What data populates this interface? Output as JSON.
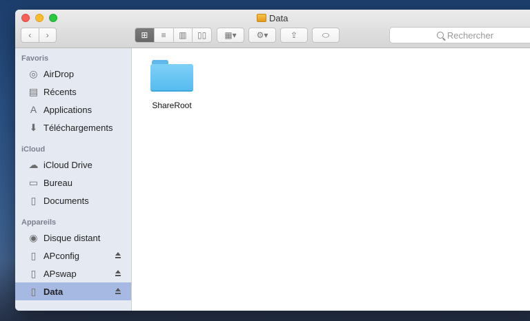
{
  "window": {
    "title": "Data"
  },
  "toolbar": {
    "back_glyph": "‹",
    "forward_glyph": "›",
    "view_icons": [
      "icon-view-icon",
      "list-view-icon",
      "column-view-icon",
      "gallery-view-icon"
    ],
    "arrange_glyph": "▦▾",
    "action_glyph": "⚙▾",
    "share_glyph": "⇪",
    "tag_glyph": "⬭"
  },
  "search": {
    "placeholder": "Rechercher"
  },
  "sidebar": {
    "sections": [
      {
        "title": "Favoris"
      },
      {
        "title": "iCloud"
      },
      {
        "title": "Appareils"
      }
    ],
    "favoris": [
      {
        "label": "AirDrop",
        "icon": "airdrop-icon",
        "glyph": "◎"
      },
      {
        "label": "Récents",
        "icon": "recents-icon",
        "glyph": "▤"
      },
      {
        "label": "Applications",
        "icon": "applications-icon",
        "glyph": "A"
      },
      {
        "label": "Téléchargements",
        "icon": "downloads-icon",
        "glyph": "⬇"
      }
    ],
    "icloud": [
      {
        "label": "iCloud Drive",
        "icon": "cloud-icon",
        "glyph": "☁"
      },
      {
        "label": "Bureau",
        "icon": "desktop-icon",
        "glyph": "▭"
      },
      {
        "label": "Documents",
        "icon": "documents-icon",
        "glyph": "▯"
      }
    ],
    "appareils": [
      {
        "label": "Disque distant",
        "icon": "remote-disc-icon",
        "glyph": "◉"
      },
      {
        "label": "APconfig",
        "icon": "drive-icon",
        "glyph": "▯"
      },
      {
        "label": "APswap",
        "icon": "drive-icon",
        "glyph": "▯"
      },
      {
        "label": "Data",
        "icon": "drive-icon",
        "glyph": "▯"
      }
    ]
  },
  "content": {
    "items": [
      {
        "label": "ShareRoot",
        "icon": "folder-icon"
      }
    ]
  },
  "colors": {
    "sidebar_bg": "#e5e9f2",
    "selection": "#a6b9e3",
    "folder": "#56bcef"
  }
}
